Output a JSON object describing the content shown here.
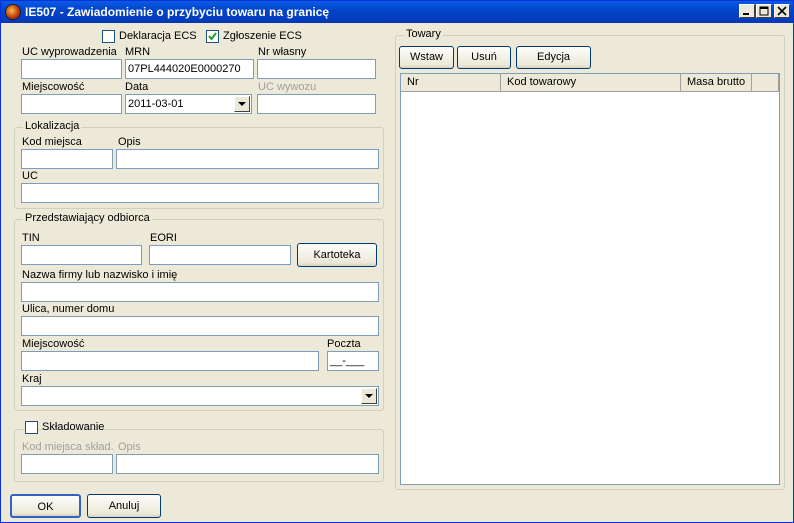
{
  "window": {
    "title": "IE507 - Zawiadomienie o przybyciu towaru na granicę"
  },
  "checkboxes": {
    "deklaracja": {
      "label": "Deklaracja ECS",
      "checked": false
    },
    "zgloszenie": {
      "label": "Zgłoszenie ECS",
      "checked": true
    }
  },
  "top": {
    "uc_wyprowadzenia": {
      "label": "UC wyprowadzenia",
      "value": ""
    },
    "mrn": {
      "label": "MRN",
      "value": "07PL444020E0000270"
    },
    "nr_wlasny": {
      "label": "Nr własny",
      "value": ""
    },
    "miejscowosc": {
      "label": "Miejscowość",
      "value": ""
    },
    "data": {
      "label": "Data",
      "value": "2011-03-01"
    },
    "uc_wywozu": {
      "label": "UC wywozu",
      "value": ""
    }
  },
  "lokalizacja": {
    "title": "Lokalizacja",
    "kod_miejsca": {
      "label": "Kod miejsca",
      "value": ""
    },
    "opis": {
      "label": "Opis",
      "value": ""
    },
    "uc": {
      "label": "UC",
      "value": ""
    }
  },
  "odbiorca": {
    "title": "Przedstawiający odbiorca",
    "tin": {
      "label": "TIN",
      "value": ""
    },
    "eori": {
      "label": "EORI",
      "value": ""
    },
    "kartoteka_label": "Kartoteka",
    "nazwa": {
      "label": "Nazwa firmy lub nazwisko i imię",
      "value": ""
    },
    "ulica": {
      "label": "Ulica, numer domu",
      "value": ""
    },
    "miejscowosc": {
      "label": "Miejscowość",
      "value": ""
    },
    "poczta": {
      "label": "Poczta",
      "value": "__-___"
    },
    "kraj": {
      "label": "Kraj",
      "value": ""
    }
  },
  "skladowanie": {
    "title": "Składowanie",
    "checked": false,
    "kod": {
      "label": "Kod miejsca skład.",
      "value": ""
    },
    "opis": {
      "label": "Opis",
      "value": ""
    }
  },
  "towary": {
    "title": "Towary",
    "buttons": {
      "wstaw": "Wstaw",
      "usun": "Usuń",
      "edycja": "Edycja"
    },
    "columns": [
      "Nr",
      "Kod towarowy",
      "Masa brutto"
    ]
  },
  "footer": {
    "ok": "OK",
    "anuluj": "Anuluj"
  }
}
